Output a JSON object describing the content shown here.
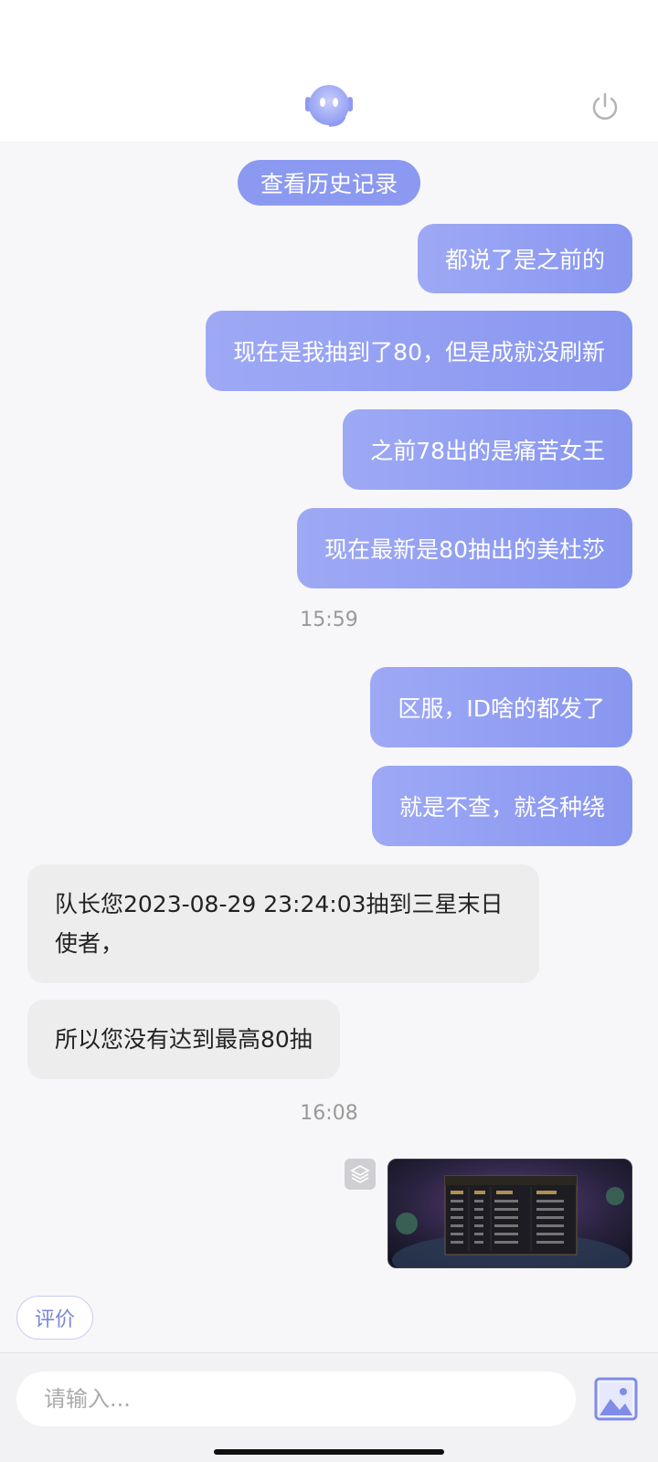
{
  "header": {
    "avatar_icon": "robot-avatar-icon",
    "power_icon": "power-icon"
  },
  "history_button": "查看历史记录",
  "messages": [
    {
      "side": "out",
      "text": "都说了是之前的"
    },
    {
      "side": "out",
      "text": "现在是我抽到了80，但是成就没刷新"
    },
    {
      "side": "out",
      "text": "之前78出的是痛苦女王"
    },
    {
      "side": "out",
      "text": "现在最新是80抽出的美杜莎"
    },
    {
      "side": "out",
      "text": "区服，ID啥的都发了"
    },
    {
      "side": "out",
      "text": "就是不查，就各种绕"
    },
    {
      "side": "in",
      "text": "队长您2023-08-29 23:24:03抽到三星末日使者，"
    },
    {
      "side": "in",
      "text": "所以您没有达到最高80抽"
    }
  ],
  "timestamps": [
    "15:59",
    "16:08"
  ],
  "rate_button": "评价",
  "input": {
    "placeholder": "请输入..."
  },
  "colors": {
    "accent": "#8c99f0",
    "incoming_bg": "#ededee"
  }
}
